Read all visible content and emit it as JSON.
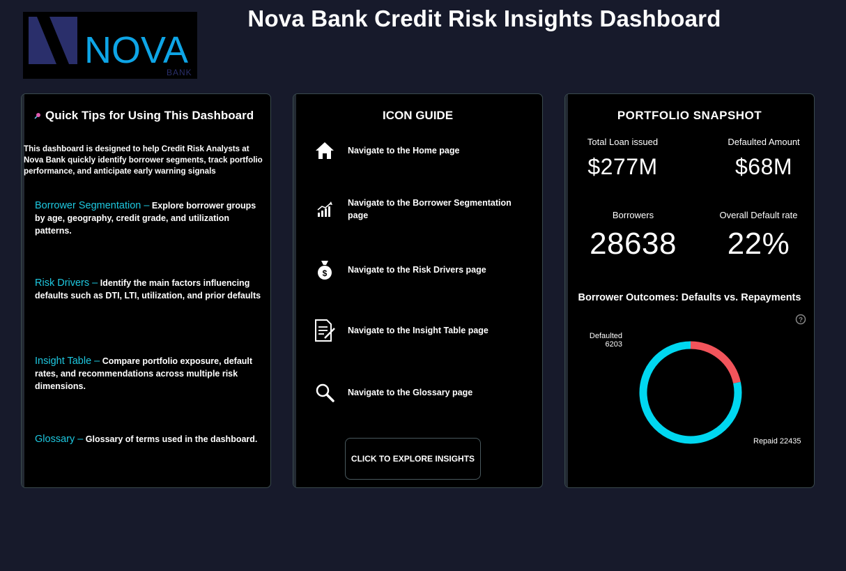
{
  "header": {
    "title": "Nova Bank Credit Risk Insights Dashboard",
    "logo_text": "NOVA",
    "logo_subtext": "BANK"
  },
  "tips": {
    "title": "Quick Tips for Using This Dashboard",
    "intro": "This dashboard is designed to help Credit Risk Analysts at Nova Bank quickly identify borrower segments, track portfolio performance, and anticipate early warning signals",
    "items": [
      {
        "name": "Borrower Segmentation –",
        "desc": "Explore borrower groups by age, geography, credit grade, and utilization patterns."
      },
      {
        "name": "Risk Drivers –",
        "desc": "Identify the main factors influencing defaults such as DTI, LTI, utilization, and prior defaults"
      },
      {
        "name": "Insight Table –",
        "desc": "Compare portfolio exposure, default rates, and recommendations across multiple risk dimensions."
      },
      {
        "name": "Glossary –",
        "desc": "Glossary of terms used in the dashboard."
      }
    ]
  },
  "icon_guide": {
    "title": "ICON GUIDE",
    "items": [
      {
        "icon": "home-icon",
        "label": "Navigate to the Home page"
      },
      {
        "icon": "chart-icon",
        "label": "Navigate to the Borrower Segmentation page"
      },
      {
        "icon": "money-bag-icon",
        "label": "Navigate to the Risk Drivers page"
      },
      {
        "icon": "document-icon",
        "label": "Navigate to the Insight Table page"
      },
      {
        "icon": "search-icon",
        "label": "Navigate to the Glossary page"
      }
    ],
    "button": "CLICK TO EXPLORE INSIGHTS"
  },
  "snapshot": {
    "title": "PORTFOLIO  SNAPSHOT",
    "kpis": {
      "total_loan_label": "Total Loan issued",
      "total_loan_value": "$277M",
      "defaulted_amount_label": "Defaulted Amount",
      "defaulted_amount_value": "$68M",
      "borrowers_label": "Borrowers",
      "borrowers_value": "28638",
      "default_rate_label": "Overall Default rate",
      "default_rate_value": "22%"
    },
    "outcomes_title": "Borrower Outcomes: Defaults vs. Repayments"
  },
  "colors": {
    "background": "#171a2b",
    "accent_cyan": "#1ec8e0",
    "defaulted": "#f2545b",
    "repaid": "#00d7f0"
  },
  "chart_data": {
    "type": "pie",
    "donut": true,
    "categories": [
      "Defaulted",
      "Repaid"
    ],
    "values": [
      6203,
      22435
    ],
    "labels": [
      {
        "name": "Defaulted",
        "value": "6203"
      },
      {
        "name": "Repaid",
        "value": "22435"
      }
    ]
  }
}
